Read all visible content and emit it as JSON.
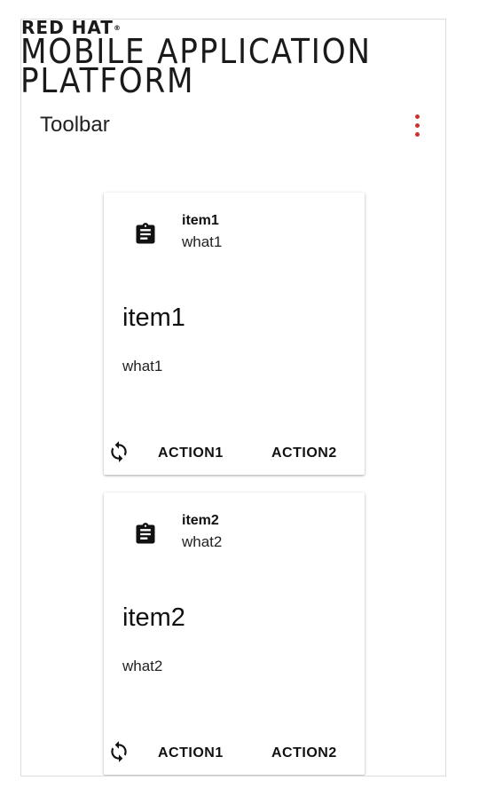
{
  "branding": {
    "red_hat": "RED HAT",
    "registered": "®",
    "line1": "MOBILE APPLICATION",
    "line2": "PLATFORM"
  },
  "toolbar": {
    "title": "Toolbar",
    "menu_icon": "more-vert-icon",
    "menu_color": "#cc3232"
  },
  "cards": [
    {
      "header_title": "item1",
      "header_subtitle": "what1",
      "avatar_icon": "assignment-icon",
      "title": "item1",
      "text": "what1",
      "refresh_icon": "refresh-icon",
      "action1": "ACTION1",
      "action2": "ACTION2"
    },
    {
      "header_title": "item2",
      "header_subtitle": "what2",
      "avatar_icon": "assignment-icon",
      "title": "item2",
      "text": "what2",
      "refresh_icon": "refresh-icon",
      "action1": "ACTION1",
      "action2": "ACTION2"
    }
  ]
}
